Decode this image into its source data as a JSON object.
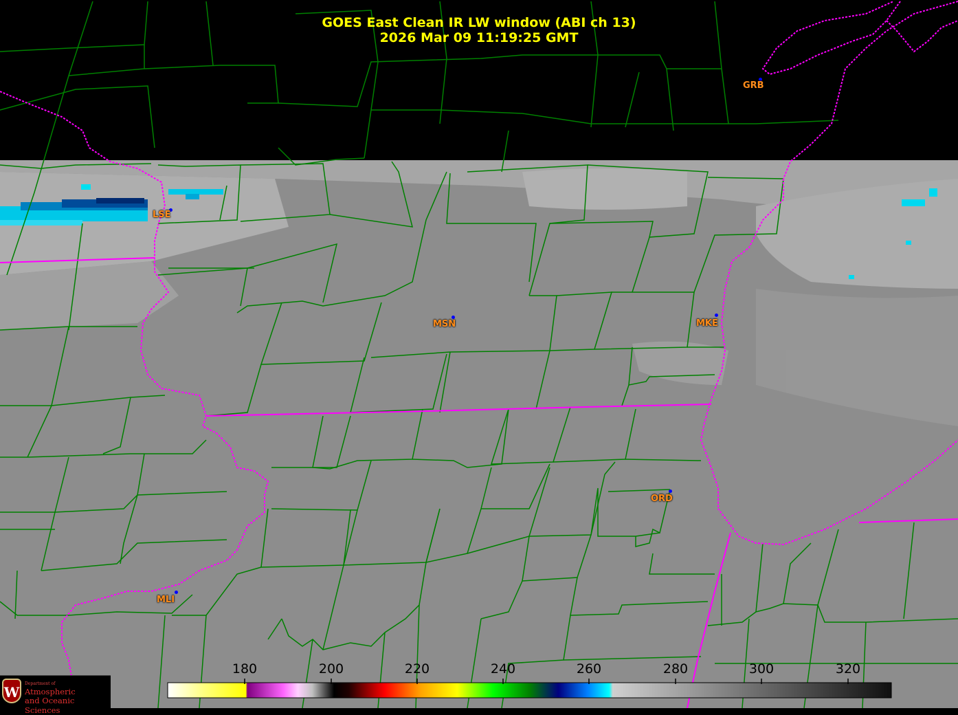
{
  "title": {
    "line1": "GOES East Clean IR LW window (ABI ch 13)",
    "line2": "2026 Mar 09  11:19:25 GMT"
  },
  "cities": [
    {
      "id": "grb",
      "label": "GRB"
    },
    {
      "id": "lse",
      "label": "LSE"
    },
    {
      "id": "msn",
      "label": "MSN"
    },
    {
      "id": "mke",
      "label": "MKE"
    },
    {
      "id": "ord",
      "label": "ORD"
    },
    {
      "id": "mli",
      "label": "MLI"
    }
  ],
  "colorbar": {
    "min": 163,
    "max": 330,
    "ticks": [
      "180",
      "200",
      "220",
      "240",
      "260",
      "280",
      "300",
      "320"
    ]
  },
  "logo": {
    "dept_of": "Department of",
    "line1": "Atmospheric",
    "line2": "and Oceanic Sciences"
  },
  "colors": {
    "title": "#ffff00",
    "county_lines": "#008000",
    "state_lines": "#ff00ff",
    "city_label": "#ff8c1a",
    "city_dot": "#0000ff"
  }
}
